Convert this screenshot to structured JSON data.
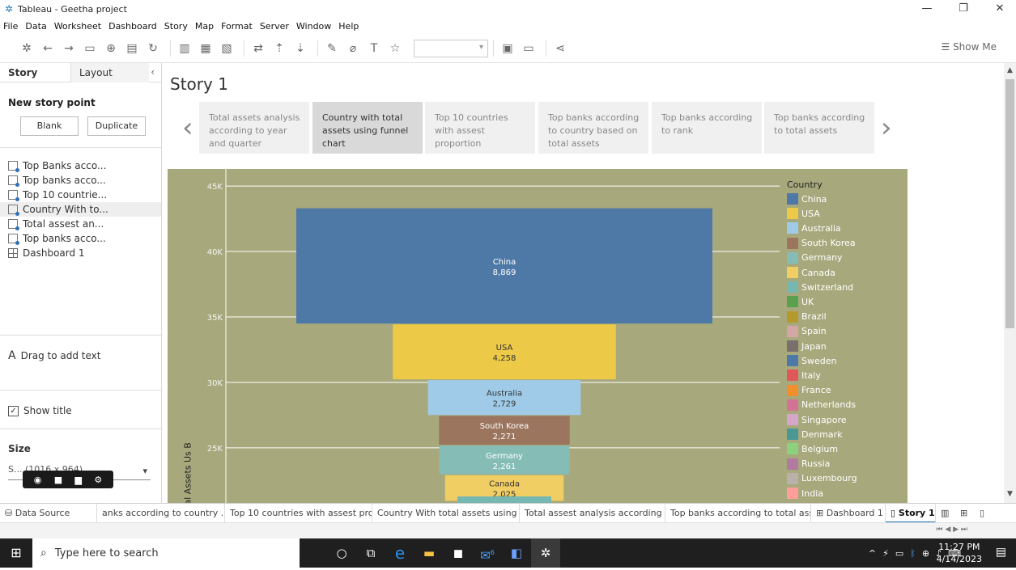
{
  "window": {
    "title": "Tableau - Geetha project"
  },
  "menu": [
    "File",
    "Data",
    "Worksheet",
    "Dashboard",
    "Story",
    "Map",
    "Format",
    "Server",
    "Window",
    "Help"
  ],
  "toolbar": {
    "show_me": "Show Me"
  },
  "sidebar": {
    "tabs": {
      "story": "Story",
      "layout": "Layout"
    },
    "new_story_point": "New story point",
    "blank": "Blank",
    "duplicate": "Duplicate",
    "sheets": [
      "Top Banks acco...",
      "Top banks acco...",
      "Top 10 countrie...",
      "Country With to...",
      "Total assest an...",
      "Top banks acco...",
      "Dashboard 1"
    ],
    "drag_text": "Drag to add text",
    "drag_glyph": "A",
    "show_title": "Show title",
    "size": "Size",
    "size_value": "S... (1016 x 964)"
  },
  "story": {
    "title": "Story 1",
    "points": [
      "Total assets analysis according to year and quarter",
      "Country with total assets using funnel chart",
      "Top 10 countries with assest proportion",
      "Top banks according to country based on total assets",
      "Top banks according to rank",
      "Top banks according to total assets"
    ]
  },
  "chart_data": {
    "type": "bar",
    "ylabel": "Total Assets Us B",
    "ylim": [
      20000,
      45500
    ],
    "y_ticks": [
      "45K",
      "40K",
      "35K",
      "30K",
      "25K"
    ],
    "legend_title": "Country",
    "legend": [
      {
        "name": "China",
        "color": "#4e79a7"
      },
      {
        "name": "USA",
        "color": "#edc948"
      },
      {
        "name": "Australia",
        "color": "#a0cbe8"
      },
      {
        "name": "South Korea",
        "color": "#9c755f"
      },
      {
        "name": "Germany",
        "color": "#86bcb6"
      },
      {
        "name": "Canada",
        "color": "#f1ce63"
      },
      {
        "name": "Switzerland",
        "color": "#76b7b2"
      },
      {
        "name": "UK",
        "color": "#59a14f"
      },
      {
        "name": "Brazil",
        "color": "#b6992d"
      },
      {
        "name": "Spain",
        "color": "#d4a6a6"
      },
      {
        "name": "Japan",
        "color": "#79706e"
      },
      {
        "name": "Sweden",
        "color": "#4e79a7"
      },
      {
        "name": "Italy",
        "color": "#e15759"
      },
      {
        "name": "France",
        "color": "#f28e2b"
      },
      {
        "name": "Netherlands",
        "color": "#d37295"
      },
      {
        "name": "Singapore",
        "color": "#d4a6c8"
      },
      {
        "name": "Denmark",
        "color": "#499894"
      },
      {
        "name": "Belgium",
        "color": "#8cd17d"
      },
      {
        "name": "Russia",
        "color": "#b07aa1"
      },
      {
        "name": "Luxembourg",
        "color": "#bab0ac"
      },
      {
        "name": "India",
        "color": "#ff9d9a"
      }
    ],
    "bars": [
      {
        "country": "China",
        "value": 8869,
        "label": "8,869",
        "top": 43300,
        "color": "#4e79a7"
      },
      {
        "country": "USA",
        "value": 4258,
        "label": "4,258",
        "top": 34431,
        "color": "#edc948"
      },
      {
        "country": "Australia",
        "value": 2729,
        "label": "2,729",
        "top": 30173,
        "color": "#a0cbe8"
      },
      {
        "country": "South Korea",
        "value": 2271,
        "label": "2,271",
        "top": 27444,
        "color": "#9c755f"
      },
      {
        "country": "Germany",
        "value": 2261,
        "label": "2,261",
        "top": 25173,
        "color": "#86bcb6"
      },
      {
        "country": "Canada",
        "value": 2025,
        "label": "2,025",
        "top": 22912,
        "color": "#f1ce63"
      }
    ]
  },
  "tabs": [
    "Data Source",
    "anks according to country ...",
    "Top 10 countries with assest pro...",
    "Country With total assets using f...",
    "Total assest analysis according t...",
    "Top banks according to total ass...",
    "Dashboard 1",
    "Story 1"
  ],
  "taskbar": {
    "search_placeholder": "Type here to search",
    "time": "11:27 PM",
    "date": "4/14/2023",
    "mail_badge": "6"
  }
}
